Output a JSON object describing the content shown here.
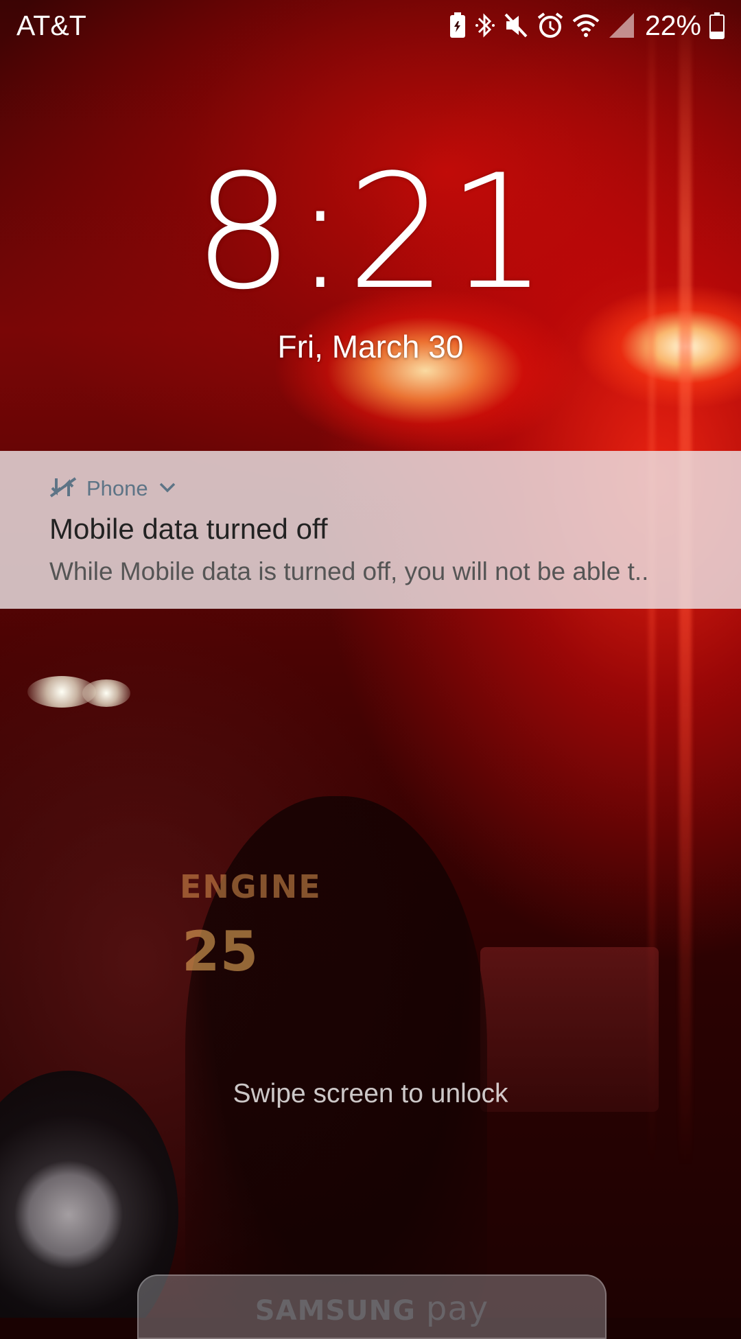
{
  "status_bar": {
    "carrier": "AT&T",
    "battery_percent": "22%",
    "icons": [
      "battery-saver-icon",
      "bluetooth-icon",
      "mute-icon",
      "alarm-icon",
      "wifi-icon",
      "signal-icon",
      "battery-icon"
    ]
  },
  "lockscreen": {
    "time": "8:21",
    "date": "Fri, March 30",
    "unlock_hint": "Swipe screen to unlock"
  },
  "notification": {
    "app_name": "Phone",
    "app_icon": "no-data-icon",
    "title": "Mobile data turned off",
    "body": "While Mobile data is turned off, you will not be able t.."
  },
  "samsung_pay": {
    "brand": "SAMSUNG",
    "product": "pay"
  },
  "wallpaper": {
    "engine_text": "ENGINE",
    "engine_number": "25"
  },
  "colors": {
    "notification_accent": "#5d7486",
    "notification_bg": "#ece4e6"
  }
}
